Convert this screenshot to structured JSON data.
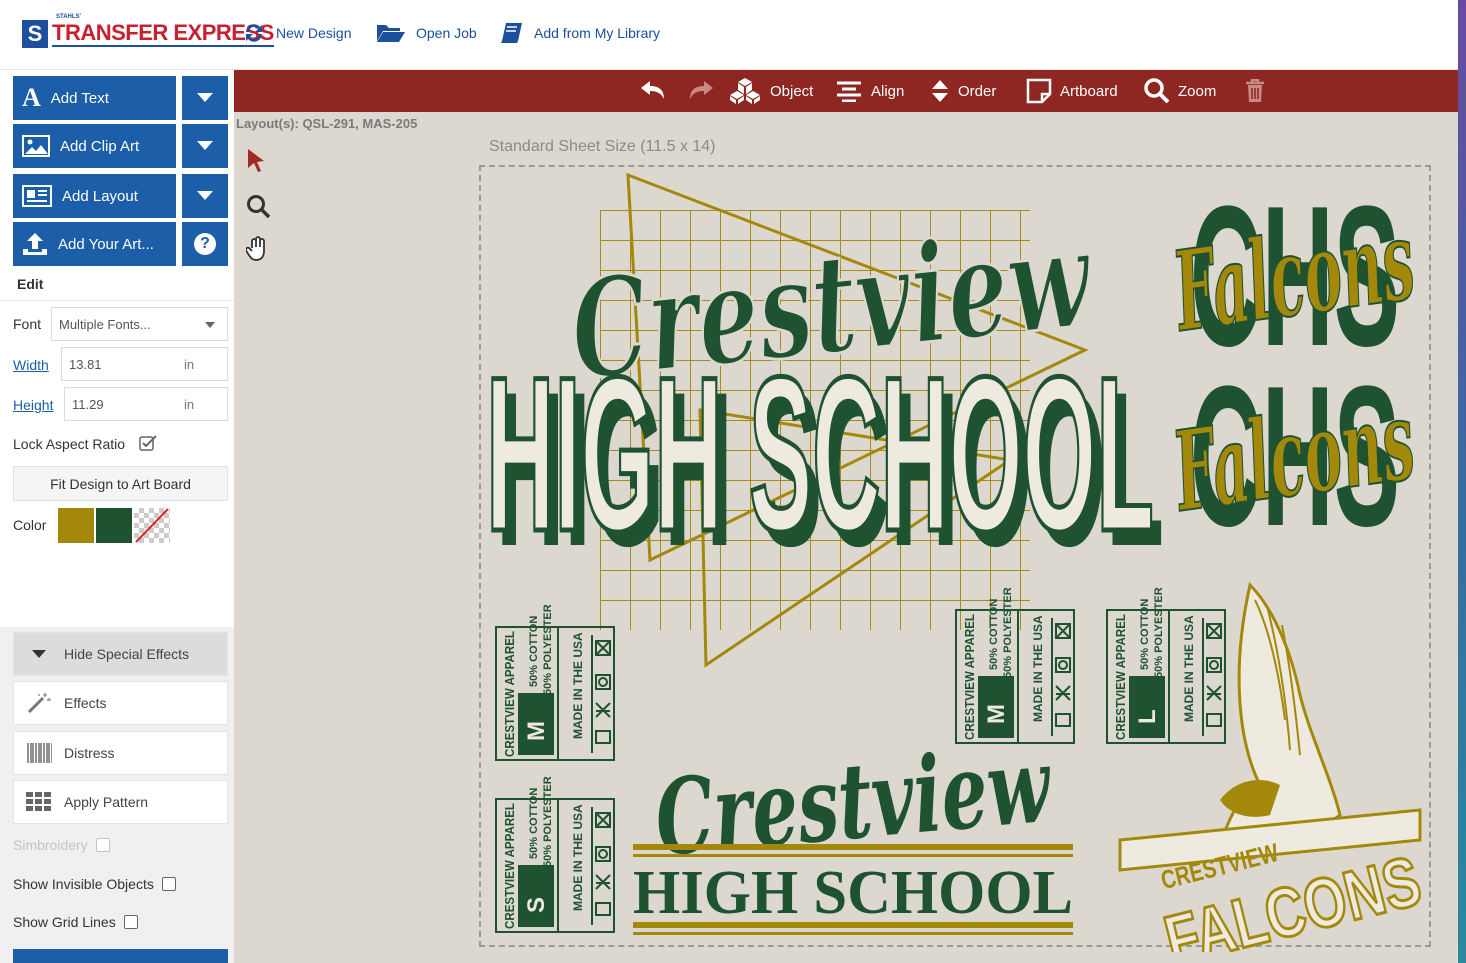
{
  "brand": {
    "small": "STAHLS'",
    "letter": "S",
    "name": "TRANSFER EXPRESS"
  },
  "topnav": {
    "new_design": "New Design",
    "open_job": "Open Job",
    "add_library": "Add from My Library"
  },
  "sidebar": {
    "add_text": "Add Text",
    "add_clip_art": "Add Clip Art",
    "add_layout": "Add Layout",
    "add_your_art": "Add Your Art...",
    "help": "?",
    "edit_heading": "Edit",
    "font_label": "Font",
    "font_value": "Multiple Fonts...",
    "width_label": "Width",
    "width_value": "13.81",
    "height_label": "Height",
    "height_value": "11.29",
    "unit": "in",
    "lock_label": "Lock Aspect Ratio",
    "fit_button": "Fit Design to Art Board",
    "color_label": "Color",
    "colors": [
      "#a3880a",
      "#1e5231"
    ],
    "hide_fx": "Hide Special Effects",
    "effects": "Effects",
    "distress": "Distress",
    "apply_pattern": "Apply Pattern",
    "simbroidery": "Simbroidery",
    "show_invisible": "Show Invisible Objects",
    "show_grid": "Show Grid Lines"
  },
  "toolbar": {
    "object": "Object",
    "align": "Align",
    "order": "Order",
    "artboard": "Artboard",
    "zoom": "Zoom"
  },
  "canvas": {
    "layouts": "Layout(s): QSL-291, MAS-205",
    "sheet_label": "Standard Sheet Size (11.5 x 14)"
  },
  "artwork": {
    "script_top": "Crestview",
    "block_top": "HIGH SCHOOL",
    "chs": "CHS",
    "falcons": "Falcons",
    "tag_brand": "CRESTVIEW APPAREL",
    "tag_cotton": "50% COTTON",
    "tag_poly": "50% POLYESTER",
    "tag_usa": "MADE IN THE USA",
    "size_m": "M",
    "size_l": "L",
    "size_s": "S",
    "script_bottom": "Crestview",
    "serif_bottom": "HIGH SCHOOL",
    "mascot_top": "CRESTVIEW",
    "mascot_bottom": "FALCONS",
    "gold": "#a3880a",
    "green": "#1e5231"
  }
}
